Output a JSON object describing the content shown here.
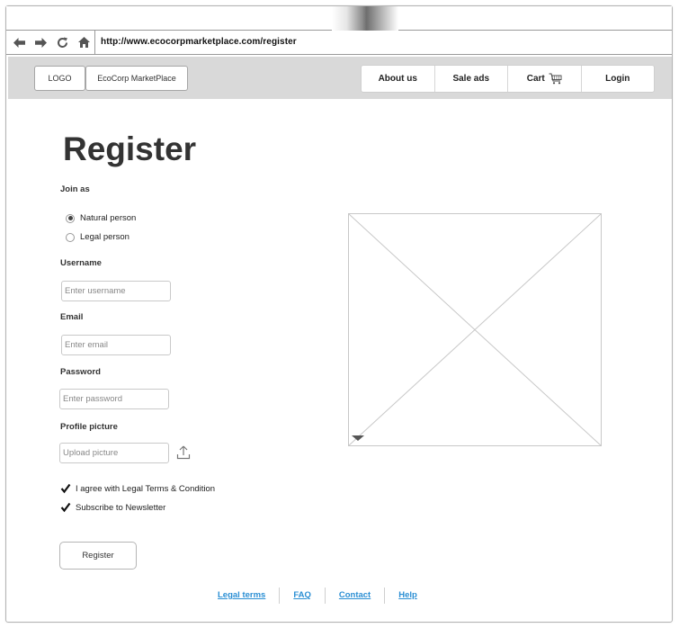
{
  "browser": {
    "url": "http://www.ecocorpmarketplace.com/register",
    "icons": [
      "back-arrow-icon",
      "forward-arrow-icon",
      "refresh-icon",
      "home-icon"
    ]
  },
  "header": {
    "logo_label": "LOGO",
    "brand_label": "EcoCorp MarketPlace",
    "nav": [
      {
        "label": "About us"
      },
      {
        "label": "Sale ads"
      },
      {
        "label": "Cart",
        "icon": "cart-icon"
      },
      {
        "label": "Login"
      }
    ]
  },
  "form": {
    "title": "Register",
    "join_as_label": "Join as",
    "join_options": [
      {
        "label": "Natural person",
        "selected": true
      },
      {
        "label": "Legal person",
        "selected": false
      }
    ],
    "username": {
      "label": "Username",
      "placeholder": "Enter username"
    },
    "email": {
      "label": "Email",
      "placeholder": "Enter email"
    },
    "password": {
      "label": "Password",
      "placeholder": "Enter password"
    },
    "picture": {
      "label": "Profile picture",
      "placeholder": "Upload picture",
      "icon": "upload-icon"
    },
    "checkboxes": [
      {
        "label": "I agree with Legal Terms & Condition",
        "checked": true
      },
      {
        "label": "Subscribe to Newsletter",
        "checked": true
      }
    ],
    "submit_label": "Register"
  },
  "footer": {
    "links": [
      "Legal terms",
      "FAQ",
      "Contact",
      "Help"
    ]
  },
  "colors": {
    "header_bg": "#d9d9d9",
    "link": "#2b8fd4",
    "title": "#333333"
  }
}
